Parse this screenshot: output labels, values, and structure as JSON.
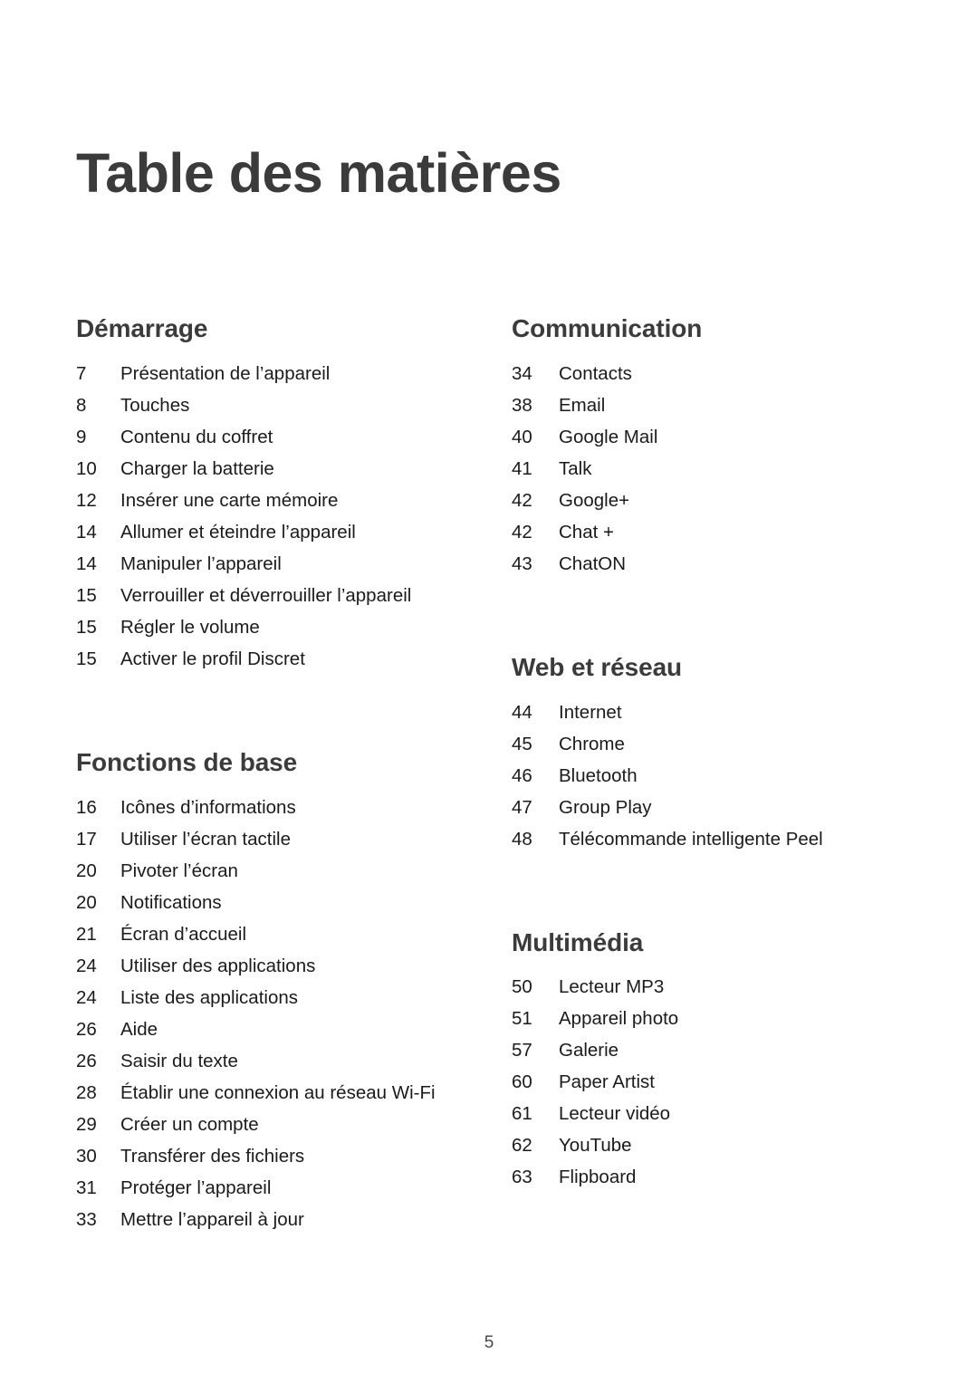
{
  "document": {
    "title": "Table des matières",
    "footer_page_number": "5"
  },
  "columns": {
    "left": [
      {
        "heading": "Démarrage",
        "entries": [
          {
            "page": "7",
            "label": "Présentation de l’appareil"
          },
          {
            "page": "8",
            "label": "Touches"
          },
          {
            "page": "9",
            "label": "Contenu du coffret"
          },
          {
            "page": "10",
            "label": "Charger la batterie"
          },
          {
            "page": "12",
            "label": "Insérer une carte mémoire"
          },
          {
            "page": "14",
            "label": "Allumer et éteindre l’appareil"
          },
          {
            "page": "14",
            "label": "Manipuler l’appareil"
          },
          {
            "page": "15",
            "label": "Verrouiller et déverrouiller l’appareil"
          },
          {
            "page": "15",
            "label": "Régler le volume"
          },
          {
            "page": "15",
            "label": "Activer le profil Discret"
          }
        ]
      },
      {
        "heading": "Fonctions de base",
        "entries": [
          {
            "page": "16",
            "label": "Icônes d’informations"
          },
          {
            "page": "17",
            "label": "Utiliser l’écran tactile"
          },
          {
            "page": "20",
            "label": "Pivoter l’écran"
          },
          {
            "page": "20",
            "label": "Notifications"
          },
          {
            "page": "21",
            "label": "Écran d’accueil"
          },
          {
            "page": "24",
            "label": "Utiliser des applications"
          },
          {
            "page": "24",
            "label": "Liste des applications"
          },
          {
            "page": "26",
            "label": "Aide"
          },
          {
            "page": "26",
            "label": "Saisir du texte"
          },
          {
            "page": "28",
            "label": "Établir une connexion au réseau Wi-Fi"
          },
          {
            "page": "29",
            "label": "Créer un compte"
          },
          {
            "page": "30",
            "label": "Transférer des fichiers"
          },
          {
            "page": "31",
            "label": "Protéger l’appareil"
          },
          {
            "page": "33",
            "label": "Mettre l’appareil à jour"
          }
        ]
      }
    ],
    "right": [
      {
        "heading": "Communication",
        "entries": [
          {
            "page": "34",
            "label": "Contacts"
          },
          {
            "page": "38",
            "label": "Email"
          },
          {
            "page": "40",
            "label": "Google Mail"
          },
          {
            "page": "41",
            "label": "Talk"
          },
          {
            "page": "42",
            "label": "Google+"
          },
          {
            "page": "42",
            "label": "Chat +"
          },
          {
            "page": "43",
            "label": "ChatON"
          }
        ]
      },
      {
        "heading": "Web et réseau",
        "entries": [
          {
            "page": "44",
            "label": "Internet"
          },
          {
            "page": "45",
            "label": "Chrome"
          },
          {
            "page": "46",
            "label": "Bluetooth"
          },
          {
            "page": "47",
            "label": "Group Play"
          },
          {
            "page": "48",
            "label": "Télécommande intelligente Peel"
          }
        ]
      },
      {
        "heading": "Multimédia",
        "entries": [
          {
            "page": "50",
            "label": "Lecteur MP3"
          },
          {
            "page": "51",
            "label": "Appareil photo"
          },
          {
            "page": "57",
            "label": "Galerie"
          },
          {
            "page": "60",
            "label": "Paper Artist"
          },
          {
            "page": "61",
            "label": "Lecteur vidéo"
          },
          {
            "page": "62",
            "label": "YouTube"
          },
          {
            "page": "63",
            "label": "Flipboard"
          }
        ]
      }
    ]
  }
}
